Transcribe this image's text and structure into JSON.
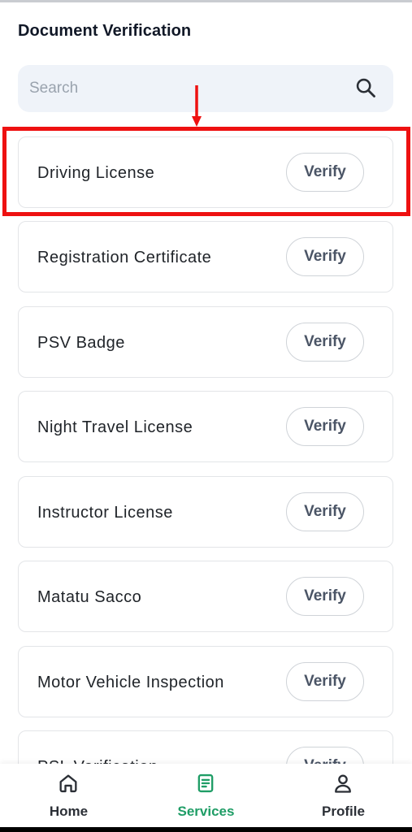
{
  "header": {
    "title": "Document Verification"
  },
  "search": {
    "placeholder": "Search",
    "value": "",
    "icon": "search-icon"
  },
  "documents": [
    {
      "label": "Driving License",
      "action": "Verify"
    },
    {
      "label": "Registration Certificate",
      "action": "Verify"
    },
    {
      "label": "PSV Badge",
      "action": "Verify"
    },
    {
      "label": "Night Travel License",
      "action": "Verify"
    },
    {
      "label": "Instructor License",
      "action": "Verify"
    },
    {
      "label": "Matatu Sacco",
      "action": "Verify"
    },
    {
      "label": "Motor Vehicle Inspection",
      "action": "Verify"
    },
    {
      "label": "PSL Verification",
      "action": "Verify"
    }
  ],
  "bottom_nav": [
    {
      "label": "Home",
      "icon": "home-icon",
      "active": false
    },
    {
      "label": "Services",
      "icon": "document-icon",
      "active": true
    },
    {
      "label": "Profile",
      "icon": "user-icon",
      "active": false
    }
  ],
  "colors": {
    "accent": "#1f9d66",
    "highlight": "#ee1111",
    "search_bg": "#eff3f9",
    "verify_text": "#4b5566"
  }
}
